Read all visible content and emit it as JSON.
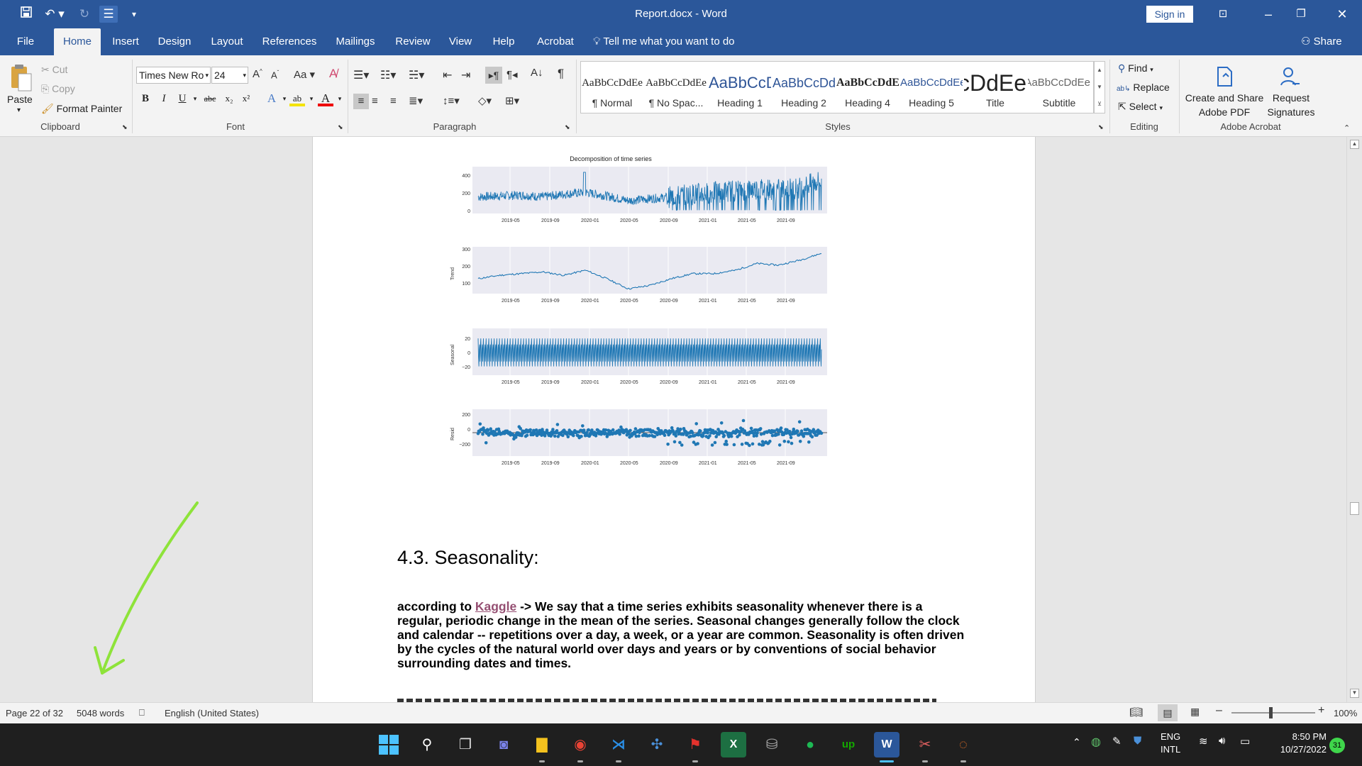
{
  "titlebar": {
    "title": "Report.docx  -  Word",
    "sign_in": "Sign in"
  },
  "tabs": [
    "File",
    "Home",
    "Insert",
    "Design",
    "Layout",
    "References",
    "Mailings",
    "Review",
    "View",
    "Help",
    "Acrobat"
  ],
  "tell_me": "Tell me what you want to do",
  "share": "Share",
  "clipboard": {
    "paste": "Paste",
    "cut": "Cut",
    "copy": "Copy",
    "format_painter": "Format Painter",
    "label": "Clipboard"
  },
  "font": {
    "name": "Times New Ro",
    "size": "24",
    "label": "Font"
  },
  "paragraph": {
    "label": "Paragraph"
  },
  "styles": {
    "label": "Styles",
    "items": [
      {
        "preview": "AaBbCcDdEe",
        "name": "¶ Normal"
      },
      {
        "preview": "AaBbCcDdEe",
        "name": "¶ No Spac..."
      },
      {
        "preview": "AaBbCcDdEe",
        "name": "Heading 1"
      },
      {
        "preview": "AaBbCcDdEe",
        "name": "Heading 2"
      },
      {
        "preview": "AaBbCcDdEe",
        "name": "Heading 4"
      },
      {
        "preview": "AaBbCcDdEe",
        "name": "Heading 5"
      },
      {
        "preview": "AaBbCcDdEe",
        "name": "Title"
      },
      {
        "preview": "AaBbCcDdEe",
        "name": "Subtitle"
      }
    ]
  },
  "editing": {
    "find": "Find",
    "replace": "Replace",
    "select": "Select",
    "label": "Editing"
  },
  "acrobat": {
    "create_share": "Create and Share",
    "create_share2": "Adobe PDF",
    "request": "Request",
    "request2": "Signatures",
    "label": "Adobe Acrobat"
  },
  "document": {
    "figure_title": "Decomposition of time series",
    "date_ticks": [
      "2019-05",
      "2019-09",
      "2020-01",
      "2020-05",
      "2020-09",
      "2021-01",
      "2021-05",
      "2021-09"
    ],
    "heading": "4.3. Seasonality:",
    "para_prefix": "according to ",
    "para_link": "Kaggle",
    "para_body": " -> We say that a time series exhibits seasonality whenever there is a regular, periodic change in the mean of the series. Seasonal changes generally follow the clock and calendar -- repetitions over a day, a week, or a year are common. Seasonality is often driven by the cycles of the natural world over days and years or by conventions of social behavior surrounding dates and times."
  },
  "chart_data": [
    {
      "type": "line",
      "title": "Decomposition of time series",
      "xlabel": "",
      "ylabel": "",
      "x_ticks": [
        "2019-05",
        "2019-09",
        "2020-01",
        "2020-05",
        "2020-09",
        "2021-01",
        "2021-05",
        "2021-09"
      ],
      "y_ticks": [
        "0",
        "200",
        "400"
      ],
      "ylim": [
        0,
        450
      ],
      "x": [
        "2019-03",
        "2019-05",
        "2019-07",
        "2019-09",
        "2019-11",
        "2020-01",
        "2020-03",
        "2020-05",
        "2020-07",
        "2020-09",
        "2020-11",
        "2021-01",
        "2021-03",
        "2021-05",
        "2021-07",
        "2021-09",
        "2021-11"
      ],
      "values": [
        150,
        160,
        170,
        150,
        180,
        200,
        160,
        110,
        130,
        150,
        180,
        200,
        220,
        240,
        230,
        250,
        330
      ]
    },
    {
      "type": "line",
      "title": "",
      "ylabel": "Trend",
      "x_ticks": [
        "2019-05",
        "2019-09",
        "2020-01",
        "2020-05",
        "2020-09",
        "2021-01",
        "2021-05",
        "2021-09"
      ],
      "y_ticks": [
        "100",
        "200",
        "300"
      ],
      "ylim": [
        70,
        330
      ],
      "x": [
        "2019-03",
        "2019-05",
        "2019-07",
        "2019-09",
        "2019-11",
        "2020-01",
        "2020-03",
        "2020-05",
        "2020-07",
        "2020-09",
        "2020-11",
        "2021-01",
        "2021-03",
        "2021-05",
        "2021-07",
        "2021-09",
        "2021-11"
      ],
      "values": [
        150,
        170,
        180,
        190,
        170,
        200,
        150,
        90,
        110,
        150,
        180,
        180,
        200,
        240,
        230,
        260,
        300
      ]
    },
    {
      "type": "line",
      "title": "",
      "ylabel": "Seasonal",
      "x_ticks": [
        "2019-05",
        "2019-09",
        "2020-01",
        "2020-05",
        "2020-09",
        "2021-01",
        "2021-05",
        "2021-09"
      ],
      "y_ticks": [
        "20",
        "0",
        "−20"
      ],
      "ylim": [
        -35,
        35
      ],
      "x": [],
      "values": []
    },
    {
      "type": "scatter",
      "title": "",
      "ylabel": "Resid",
      "x_ticks": [
        "2019-05",
        "2019-09",
        "2020-01",
        "2020-05",
        "2020-09",
        "2021-01",
        "2021-05",
        "2021-09"
      ],
      "y_ticks": [
        "200",
        "0",
        "−200"
      ],
      "ylim": [
        -300,
        300
      ],
      "x": [],
      "values": []
    }
  ],
  "status": {
    "page": "Page 22 of 32",
    "words": "5048 words",
    "language": "English (United States)",
    "zoom": "100%"
  },
  "taskbar": {
    "lang1": "ENG",
    "lang2": "INTL",
    "time": "8:50 PM",
    "date": "10/27/2022",
    "badge": "31"
  }
}
